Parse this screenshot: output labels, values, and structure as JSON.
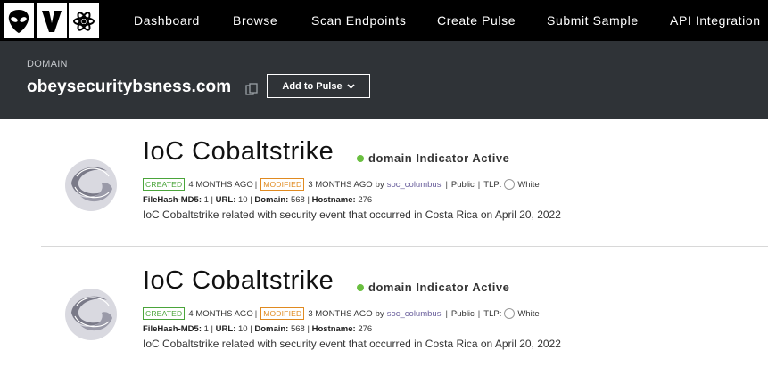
{
  "nav": {
    "items": [
      "Dashboard",
      "Browse",
      "Scan Endpoints",
      "Create Pulse",
      "Submit Sample",
      "API Integration"
    ]
  },
  "header": {
    "label": "DOMAIN",
    "domain": "obeysecuritybsness.com",
    "add_to_pulse": "Add to Pulse"
  },
  "pulses": [
    {
      "title": "IoC Cobaltstrike",
      "status": "domain Indicator Active",
      "created_badge": "CREATED",
      "created_ago": "4 MONTHS AGO",
      "modified_badge": "MODIFIED",
      "modified_ago": "3 MONTHS AGO",
      "by": "by",
      "author": "soc_columbus",
      "visibility": "Public",
      "tlp_label": "TLP:",
      "tlp_value": "White",
      "stats": [
        {
          "label": "FileHash-MD5:",
          "value": "1"
        },
        {
          "label": "URL:",
          "value": "10"
        },
        {
          "label": "Domain:",
          "value": "568"
        },
        {
          "label": "Hostname:",
          "value": "276"
        }
      ],
      "description": "IoC Cobaltstrike related with security event that occurred in Costa Rica on April 20, 2022"
    },
    {
      "title": "IoC Cobaltstrike",
      "status": "domain Indicator Active",
      "created_badge": "CREATED",
      "created_ago": "4 MONTHS AGO",
      "modified_badge": "MODIFIED",
      "modified_ago": "3 MONTHS AGO",
      "by": "by",
      "author": "soc_columbus",
      "visibility": "Public",
      "tlp_label": "TLP:",
      "tlp_value": "White",
      "stats": [
        {
          "label": "FileHash-MD5:",
          "value": "1"
        },
        {
          "label": "URL:",
          "value": "10"
        },
        {
          "label": "Domain:",
          "value": "568"
        },
        {
          "label": "Hostname:",
          "value": "276"
        }
      ],
      "description": "IoC Cobaltstrike related with security event that occurred in Costa Rica on April 20, 2022"
    }
  ],
  "colors": {
    "nav_bg": "#000000",
    "header_bg": "#2f3337",
    "active_dot": "#6abf40",
    "created": "#4aa43a",
    "modified": "#e08a20",
    "author_link": "#6a5f9c"
  },
  "icons": {
    "logo": "alien-logo",
    "copy": "copy-icon",
    "chevron": "chevron-down-icon",
    "pulse": "pulse-swirl-icon"
  }
}
